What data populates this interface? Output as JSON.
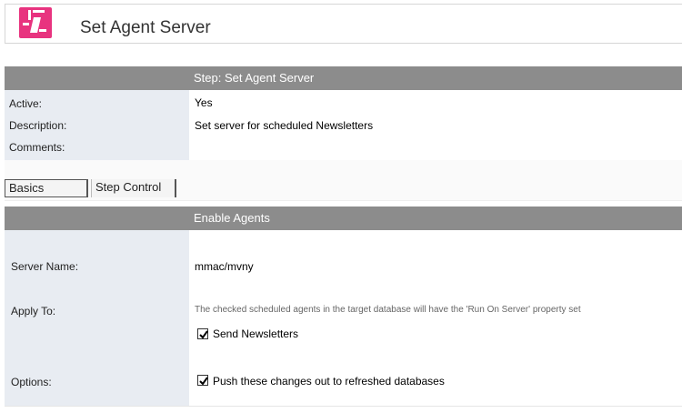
{
  "header": {
    "title": "Set Agent Server"
  },
  "step": {
    "bar_title": "Step:  Set Agent Server",
    "active_label": "Active:",
    "active_value": "Yes",
    "description_label": "Description:",
    "description_value": "Set server for scheduled Newsletters",
    "comments_label": "Comments:",
    "comments_value": ""
  },
  "tabs": [
    {
      "label": "Basics",
      "selected": true
    },
    {
      "label": "Step Control",
      "selected": false
    }
  ],
  "section": {
    "title": "Enable Agents",
    "server_name_label": "Server Name:",
    "server_name_value": "mmac/mvny",
    "apply_to_label": "Apply To:",
    "apply_to_note": "The checked scheduled agents in the target database will have the 'Run On Server' property set",
    "send_newsletters_label": "Send Newsletters",
    "send_newsletters_checked": true,
    "options_label": "Options:",
    "push_changes_label": "Push these changes out to refreshed databases",
    "push_changes_checked": true
  },
  "colors": {
    "logo_pink": "#e8337f",
    "bar_gray": "#8c8c8c",
    "label_column": "#e8ecf2"
  }
}
